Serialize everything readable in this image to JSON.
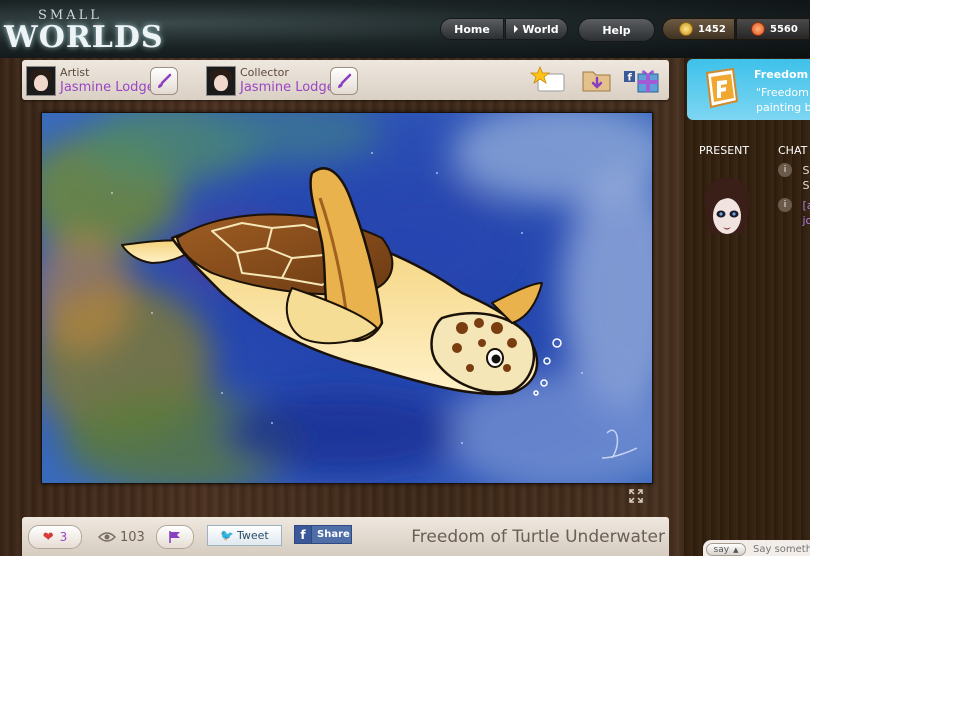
{
  "logo": {
    "small": "SMALL",
    "worlds": "WORLDS"
  },
  "nav": {
    "home": "Home",
    "world": "World",
    "help": "Help"
  },
  "currency": {
    "coins": "1452",
    "gems": "5560"
  },
  "artwork": {
    "artist_role": "Artist",
    "artist_name": "Jasmine Lodge",
    "collector_role": "Collector",
    "collector_name": "Jasmine Lodge",
    "title": "Freedom of Turtle Underwater",
    "likes": "3",
    "views": "103"
  },
  "social": {
    "tweet": "Tweet",
    "share": "Share",
    "fb_letter": "f"
  },
  "announcement": {
    "title": "Freedom of",
    "line1": "\"Freedom o",
    "line2": "painting by"
  },
  "panel": {
    "present_label": "PRESENT",
    "chat_label": "CHAT"
  },
  "chat": [
    {
      "icon": "i",
      "line1": "Su",
      "line2": "Su"
    },
    {
      "icon": "i",
      "line1": "[a",
      "line2": "jo"
    }
  ],
  "chat_input": {
    "say_label": "say",
    "placeholder": "Say something"
  },
  "colors": {
    "accent_purple": "#9a45c6",
    "announce_blue": "#3ec1ea",
    "facebook_blue": "#3b5998"
  }
}
